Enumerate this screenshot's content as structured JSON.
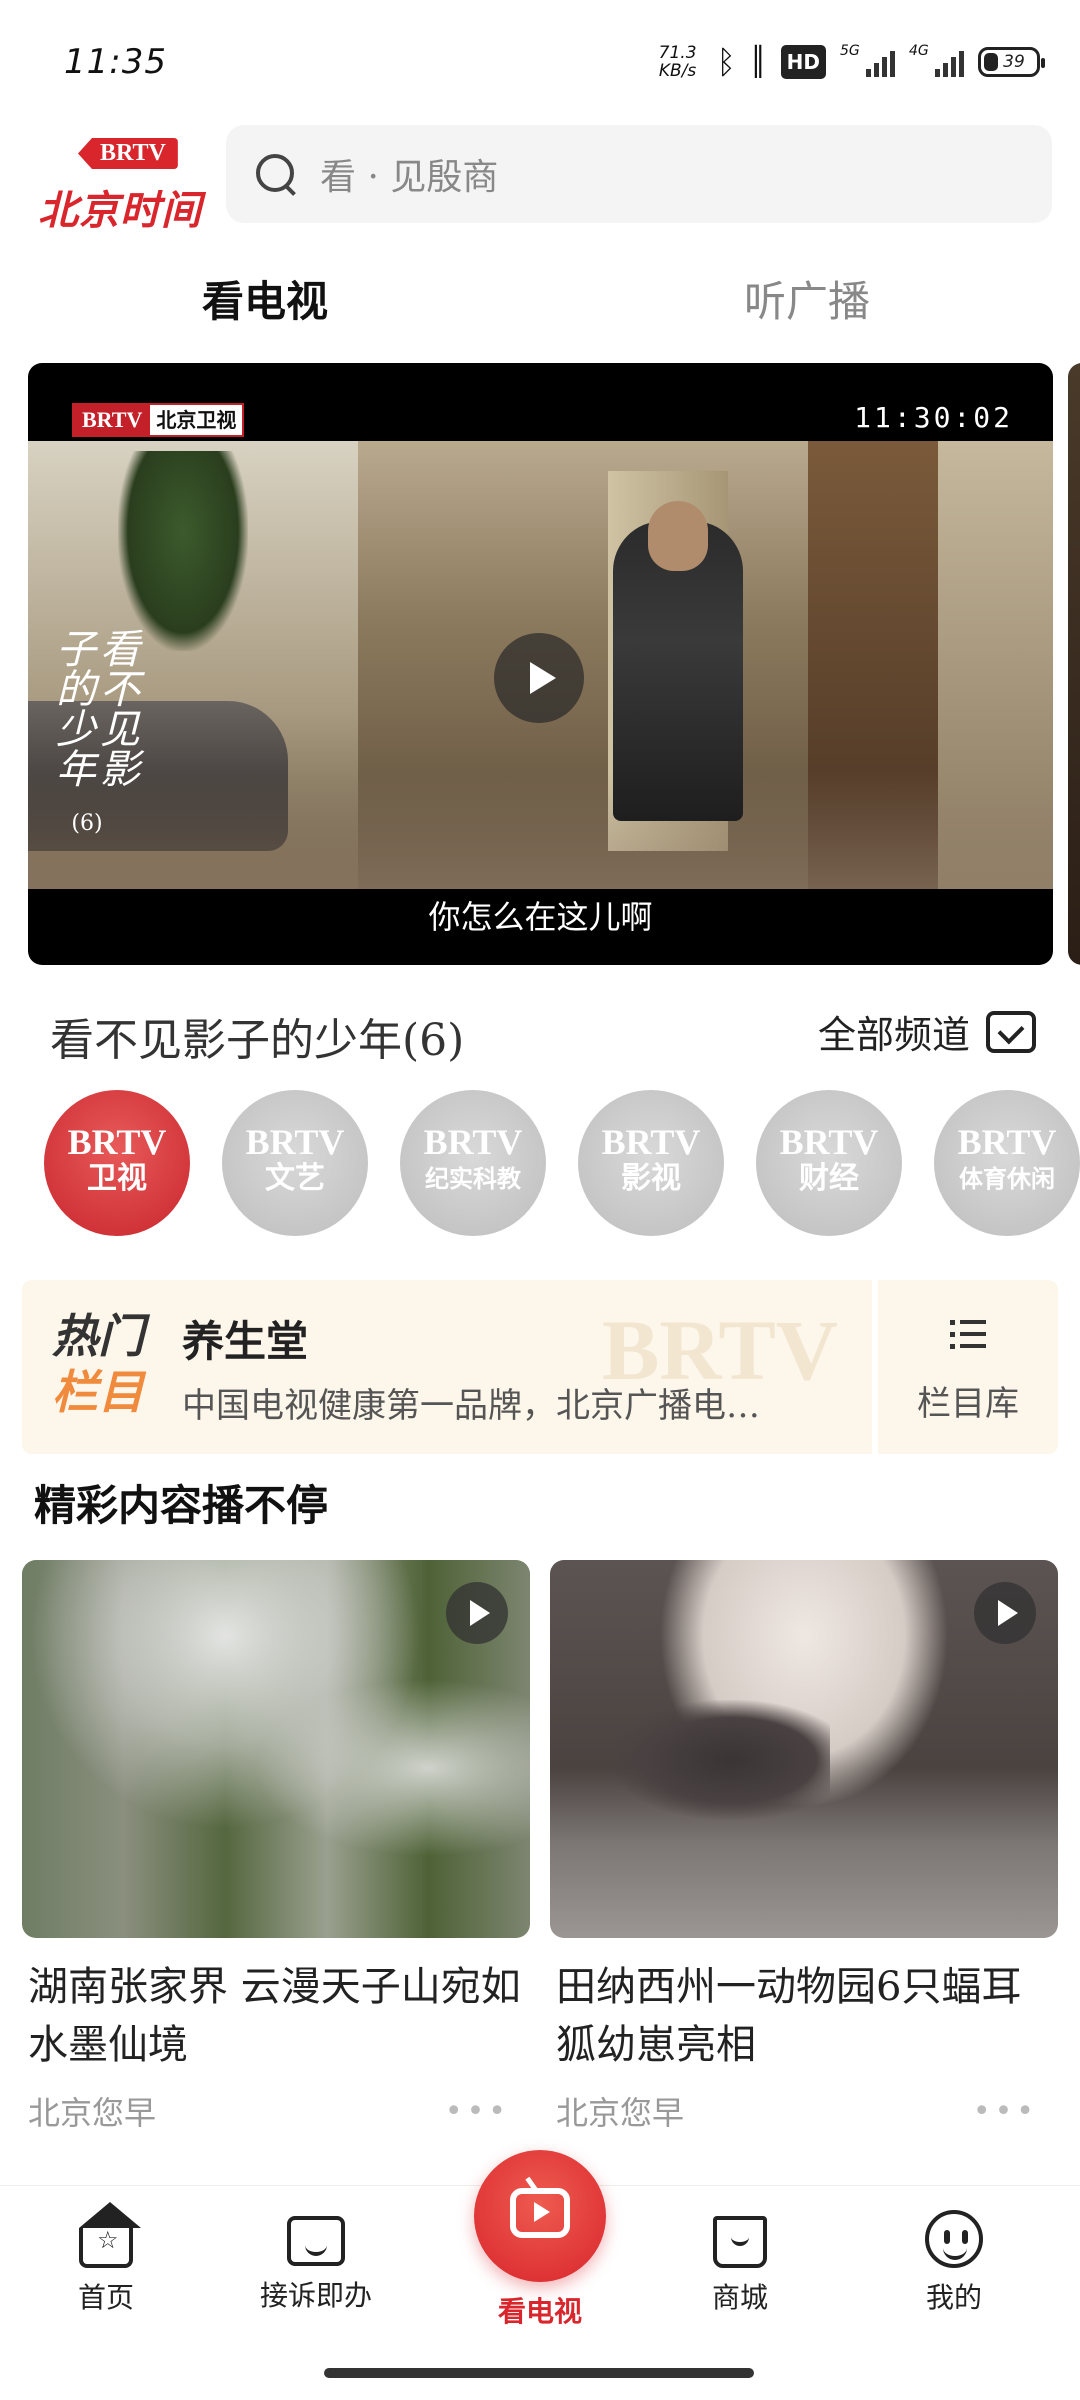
{
  "status_bar": {
    "time": "11:35",
    "net_speed_value": "71.3",
    "net_speed_unit": "KB/s",
    "hd_badge": "HD",
    "signal_1_label": "5G",
    "signal_2_label": "4G",
    "battery": "39"
  },
  "header": {
    "logo_brtv": "BRTV",
    "logo_text": "北京时间",
    "search_placeholder": "看 · 见殷商"
  },
  "tabs": [
    {
      "label": "看电视",
      "active": true
    },
    {
      "label": "听广播",
      "active": false
    }
  ],
  "player": {
    "channel_brand": "BRTV",
    "channel_name": "北京卫视",
    "clock": "11:30:02",
    "side_title": "看不见影子的少年",
    "side_title_episode": "(6)",
    "subtitle": "你怎么在这儿啊"
  },
  "now_playing": {
    "title": "看不见影子的少年(6)",
    "all_channels_label": "全部频道"
  },
  "channels": [
    {
      "brand": "BRTV",
      "name": "卫视",
      "active": true
    },
    {
      "brand": "BRTV",
      "name": "文艺",
      "active": false
    },
    {
      "brand": "BRTV",
      "name": "纪实科教",
      "active": false
    },
    {
      "brand": "BRTV",
      "name": "影视",
      "active": false
    },
    {
      "brand": "BRTV",
      "name": "财经",
      "active": false
    },
    {
      "brand": "BRTV",
      "name": "体育休闲",
      "active": false
    }
  ],
  "hot_column": {
    "badge_line1": "热门",
    "badge_line2": "栏目",
    "name": "养生堂",
    "description": "中国电视健康第一品牌，北京广播电…",
    "watermark": "BRTV",
    "library_label": "栏目库"
  },
  "section": {
    "title": "精彩内容播不停"
  },
  "cards": [
    {
      "title": "湖南张家界  云漫天子山宛如水墨仙境",
      "source": "北京您早",
      "more": "•••"
    },
    {
      "title": "田纳西州一动物园6只蝠耳狐幼崽亮相",
      "source": "北京您早",
      "more": "•••"
    }
  ],
  "bottom_nav": [
    {
      "label": "首页",
      "icon": "home-icon"
    },
    {
      "label": "接诉即办",
      "icon": "chat-icon"
    },
    {
      "label": "看电视",
      "icon": "tv-play-icon",
      "active": true
    },
    {
      "label": "商城",
      "icon": "shopping-bag-icon"
    },
    {
      "label": "我的",
      "icon": "profile-face-icon"
    }
  ],
  "colors": {
    "accent": "#d9252c",
    "hot_orange": "#f08a3c",
    "banner_bg": "#fdf6ea"
  }
}
